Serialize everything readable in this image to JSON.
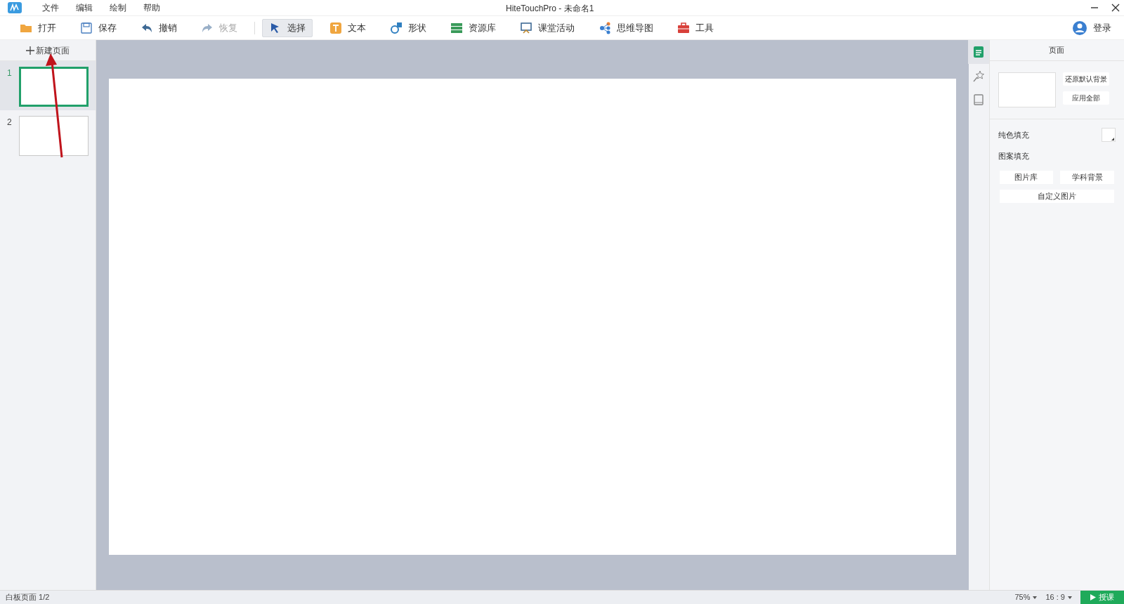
{
  "window": {
    "title": "HiteTouchPro - 未命名1"
  },
  "menu": [
    "文件",
    "编辑",
    "绘制",
    "帮助"
  ],
  "toolbar": [
    {
      "label": "打开",
      "kind": "open",
      "disabled": false,
      "selected": false
    },
    {
      "label": "保存",
      "kind": "save",
      "disabled": false,
      "selected": false
    },
    {
      "label": "撤销",
      "kind": "undo",
      "disabled": false,
      "selected": false
    },
    {
      "label": "恢复",
      "kind": "redo",
      "disabled": true,
      "selected": false
    },
    {
      "label": "选择",
      "kind": "select",
      "disabled": false,
      "selected": true
    },
    {
      "label": "文本",
      "kind": "text",
      "disabled": false,
      "selected": false
    },
    {
      "label": "形状",
      "kind": "shape",
      "disabled": false,
      "selected": false
    },
    {
      "label": "资源库",
      "kind": "library",
      "disabled": false,
      "selected": false
    },
    {
      "label": "课堂活动",
      "kind": "activity",
      "disabled": false,
      "selected": false
    },
    {
      "label": "思维导图",
      "kind": "mindmap",
      "disabled": false,
      "selected": false
    },
    {
      "label": "工具",
      "kind": "tools",
      "disabled": false,
      "selected": false
    }
  ],
  "login": "登录",
  "pages_panel": {
    "new_page": "新建页面",
    "pages": [
      {
        "number": "1",
        "selected": true
      },
      {
        "number": "2",
        "selected": false
      }
    ]
  },
  "side_tabs": [
    {
      "kind": "page",
      "selected": true
    },
    {
      "kind": "animation",
      "selected": false
    },
    {
      "kind": "board",
      "selected": false
    }
  ],
  "properties": {
    "title": "页面",
    "restore_button": "还原默认背景",
    "apply_all_button": "应用全部",
    "solid_fill": "纯色填充",
    "pattern_fill": "图案填充",
    "gallery_button": "图片库",
    "subject_button": "学科背景",
    "custom_button": "自定义图片"
  },
  "status_bar": {
    "page_info": "白板页面 1/2",
    "zoom": "75%",
    "ratio": "16 : 9",
    "teach_button": "授课"
  }
}
